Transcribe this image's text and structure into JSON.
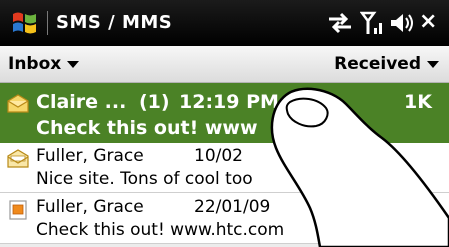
{
  "titlebar": {
    "title": "SMS / MMS",
    "close_label": "×",
    "icons": [
      "windows-start-icon",
      "connectivity-icon",
      "signal-icon",
      "volume-icon"
    ]
  },
  "sortbar": {
    "folder": "Inbox",
    "sort_by": "Received"
  },
  "messages": [
    {
      "sender": "Claire ...",
      "count": "(1)",
      "time": "12:19 PM",
      "size": "1K",
      "preview": "Check this out! www",
      "selected": true,
      "icon": "unread-envelope-icon"
    },
    {
      "sender": "Fuller, Grace",
      "time": "10/02",
      "preview": "Nice site. Tons of cool too",
      "selected": false,
      "icon": "read-envelope-icon"
    },
    {
      "sender": "Fuller, Grace",
      "time": "22/01/09",
      "preview": "Check this out! www.htc.com",
      "selected": false,
      "icon": "mms-icon"
    }
  ],
  "colors": {
    "title_bg": "#000000",
    "selected_row": "#4b8226",
    "sort_bar": "#e6e6e6"
  }
}
